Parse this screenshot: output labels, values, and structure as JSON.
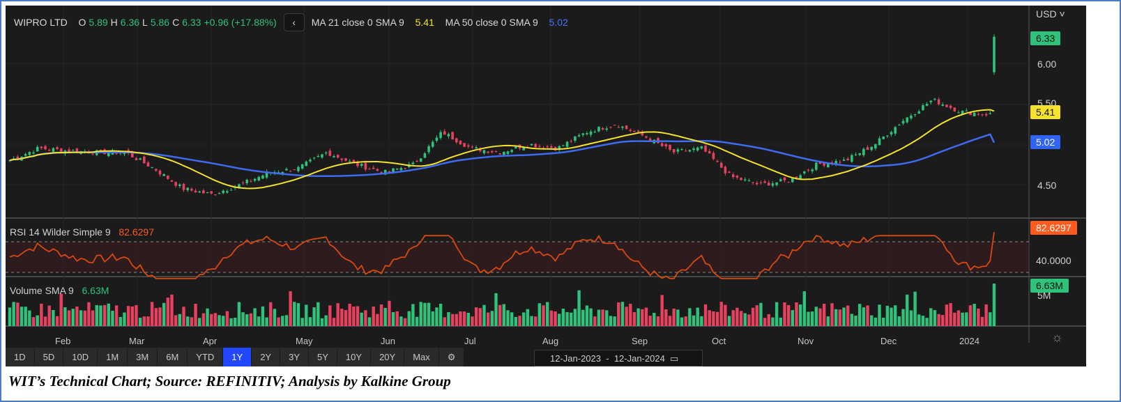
{
  "header": {
    "symbol": "WIPRO LTD",
    "o_label": "O",
    "o": "5.89",
    "h_label": "H",
    "h": "6.36",
    "l_label": "L",
    "l": "5.86",
    "c_label": "C",
    "c": "6.33",
    "change": "+0.96 (+17.88%)",
    "collapse": "‹",
    "ma21_label": "MA 21 close 0 SMA 9",
    "ma21": "5.41",
    "ma50_label": "MA 50 close 0 SMA 9",
    "ma50": "5.02"
  },
  "axis": {
    "currency": "USD ˅",
    "ticks": [
      "6.00",
      "5.50",
      "4.50"
    ],
    "last_price": "6.33",
    "ma21_tag": "5.41",
    "ma50_tag": "5.02"
  },
  "rsi": {
    "label": "RSI 14 Wilder Simple 9",
    "value": "82.6297",
    "tag": "82.6297",
    "tick": "40.0000"
  },
  "volume": {
    "label": "Volume SMA 9",
    "value": "6.63M",
    "tag": "6.63M",
    "tick": "5M"
  },
  "months": [
    "Feb",
    "Mar",
    "Apr",
    "May",
    "Jun",
    "Jul",
    "Aug",
    "Sep",
    "Oct",
    "Nov",
    "Dec",
    "2024"
  ],
  "periods": [
    "1D",
    "5D",
    "10D",
    "1M",
    "3M",
    "6M",
    "YTD",
    "1Y",
    "2Y",
    "3Y",
    "5Y",
    "10Y",
    "20Y",
    "Max"
  ],
  "active_period": "1Y",
  "date_range": {
    "from": "12-Jan-2023",
    "sep": "-",
    "to": "12-Jan-2024"
  },
  "caption": "WIT’s Technical Chart; Source: REFINITIV; Analysis by Kalkine Group",
  "colors": {
    "up": "#2fc27a",
    "down": "#e8405f",
    "ma21": "#f4e22d",
    "ma50": "#3d6cf0",
    "rsi": "#d9480f",
    "active": "#2347ff"
  },
  "chart_data": {
    "type": "candlestick",
    "title": "WIPRO LTD",
    "ylim": [
      4.2,
      6.5
    ],
    "close_path": [
      4.8,
      4.95,
      4.92,
      4.9,
      4.9,
      4.7,
      4.45,
      4.38,
      4.5,
      4.65,
      4.7,
      4.9,
      4.75,
      4.65,
      4.75,
      5.15,
      4.95,
      4.9,
      5.0,
      4.95,
      5.15,
      5.25,
      5.1,
      4.9,
      4.95,
      4.6,
      4.5,
      4.55,
      4.75,
      4.8,
      5.0,
      5.3,
      5.55,
      5.4,
      5.37,
      6.33
    ],
    "ma21_end": 5.41,
    "ma50_end": 5.02,
    "rsi_levels": [
      30,
      70
    ],
    "rsi_last": 82.63,
    "volume_last_m": 6.63
  }
}
